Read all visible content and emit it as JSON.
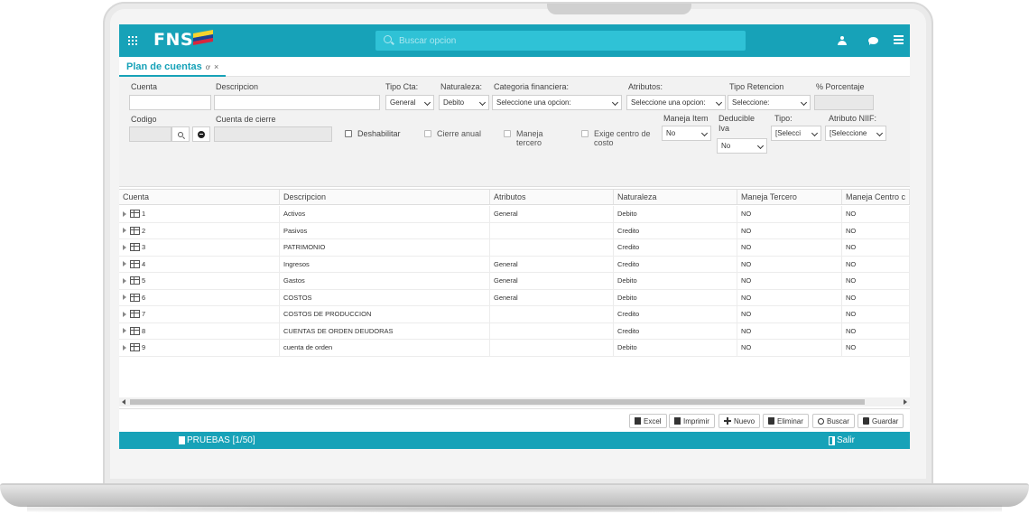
{
  "app": {
    "logo_text": "FNS",
    "logo_suffix": "co",
    "search_placeholder": "Buscar opcion"
  },
  "tab": {
    "label": "Plan de cuentas",
    "ref_glyph": "ơ",
    "close_glyph": "×"
  },
  "form": {
    "cuenta_label": "Cuenta",
    "descripcion_label": "Descripcion",
    "tipo_cta_label": "Tipo Cta:",
    "tipo_cta_value": "General",
    "naturaleza_label": "Naturaleza:",
    "naturaleza_value": "Debito",
    "categoria_label": "Categoria financiera:",
    "categoria_value": "Seleccione una opcion:",
    "atributos_label": "Atributos:",
    "atributos_value": "Seleccione una opcion:",
    "tipo_retencion_label": "Tipo Retencion",
    "tipo_retencion_value": "Seleccione:",
    "porcentaje_label": "% Porcentaje",
    "codigo_label": "Codigo",
    "cuenta_cierre_label": "Cuenta de cierre",
    "deshabilitar_label": "Deshabilitar",
    "cierre_anual_label": "Cierre anual",
    "maneja_tercero_label_1": "Maneja",
    "maneja_tercero_label_2": "tercero",
    "exige_centro_label_1": "Exige centro de",
    "exige_centro_label_2": "costo",
    "maneja_item_label": "Maneja Item",
    "maneja_item_value": "No",
    "deducible_label_1": "Deducible",
    "deducible_label_2": "Iva",
    "deducible_value": "No",
    "tipo_label": "Tipo:",
    "tipo_value": "[Selecci",
    "atributo_niif_label": "Atributo NIIF:",
    "atributo_niif_value": "[Seleccione"
  },
  "grid": {
    "columns": [
      "Cuenta",
      "Descripcion",
      "Atributos",
      "Naturaleza",
      "Maneja Tercero",
      "Maneja Centro c"
    ],
    "rows": [
      {
        "cuenta": "1",
        "descripcion": "Activos",
        "atributos": "General",
        "naturaleza": "Debito",
        "tercero": "NO",
        "centro": "NO"
      },
      {
        "cuenta": "2",
        "descripcion": "Pasivos",
        "atributos": "",
        "naturaleza": "Credito",
        "tercero": "NO",
        "centro": "NO"
      },
      {
        "cuenta": "3",
        "descripcion": "PATRIMONIO",
        "atributos": "",
        "naturaleza": "Credito",
        "tercero": "NO",
        "centro": "NO"
      },
      {
        "cuenta": "4",
        "descripcion": "Ingresos",
        "atributos": "General",
        "naturaleza": "Credito",
        "tercero": "NO",
        "centro": "NO"
      },
      {
        "cuenta": "5",
        "descripcion": "Gastos",
        "atributos": "General",
        "naturaleza": "Debito",
        "tercero": "NO",
        "centro": "NO"
      },
      {
        "cuenta": "6",
        "descripcion": "COSTOS",
        "atributos": "General",
        "naturaleza": "Debito",
        "tercero": "NO",
        "centro": "NO"
      },
      {
        "cuenta": "7",
        "descripcion": "COSTOS DE PRODUCCION",
        "atributos": "",
        "naturaleza": "Credito",
        "tercero": "NO",
        "centro": "NO"
      },
      {
        "cuenta": "8",
        "descripcion": "CUENTAS DE ORDEN DEUDORAS",
        "atributos": "",
        "naturaleza": "Credito",
        "tercero": "NO",
        "centro": "NO"
      },
      {
        "cuenta": "9",
        "descripcion": "cuenta de orden",
        "atributos": "",
        "naturaleza": "Debito",
        "tercero": "NO",
        "centro": "NO"
      }
    ]
  },
  "toolbar": {
    "excel": "Excel",
    "imprimir": "Imprimir",
    "nuevo": "Nuevo",
    "eliminar": "Eliminar",
    "buscar": "Buscar",
    "guardar": "Guardar"
  },
  "status": {
    "environment": "PRUEBAS [1/50]",
    "exit": "Salir"
  },
  "colors": {
    "accent": "#17a2b8",
    "search_bg": "#2fc2d6"
  }
}
